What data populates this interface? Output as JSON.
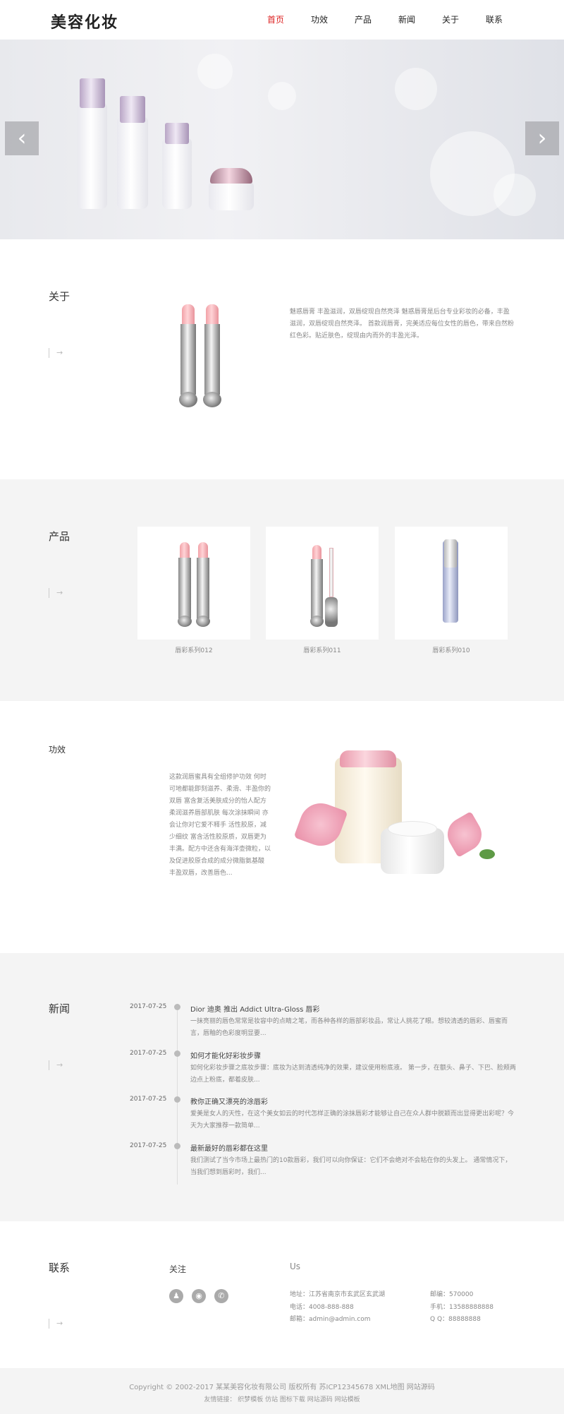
{
  "header": {
    "logo": "美容化妆",
    "nav": [
      "首页",
      "功效",
      "产品",
      "新闻",
      "关于",
      "联系"
    ]
  },
  "banner": {
    "prev_glyph": "‹",
    "next_glyph": "›"
  },
  "about": {
    "title": "关于",
    "more": "→",
    "text": "魅惑唇膏 丰盈滋润，双唇绽现自然亮泽 魅惑唇膏是后台专业彩妆的必备，丰盈滋润，双唇绽现自然亮泽。 首款润唇膏，完美适应每位女性的唇色，带来自然粉红色彩。贴近肤色，绽现由内而外的丰盈光泽。"
  },
  "products": {
    "title": "产品",
    "more": "→",
    "items": [
      {
        "label": "唇彩系列012"
      },
      {
        "label": "唇彩系列011"
      },
      {
        "label": "唇彩系列010"
      }
    ]
  },
  "effect": {
    "title": "功效",
    "text": "这款润唇蜜具有全组修护功效 何时可地都能即刻滋养、柔滑、丰盈你的双唇 富含复活美肤成分的怡人配方 柔润滋养唇部肌肤 每次涂抹瞬间 亦会让你对它爱不释手 活性胶原，减少细纹 富含活性胶原质，双唇更为丰满。配方中还含有海洋壶微粒，以及促进胶原合成的成分微脂氨基酸 丰盈双唇，改善唇色..."
  },
  "news": {
    "title": "新闻",
    "more": "→",
    "items": [
      {
        "date": "2017-07-25",
        "title": "Dior 迪奥 推出 Addict Ultra-Gloss 唇彩",
        "desc": "一抹亮丽的唇色常常是妆容中的点睛之笔，而各种各样的唇部彩妆品，常让人挑花了眼。想较清透的唇彩、唇蜜而言，唇釉的色彩度明显要..."
      },
      {
        "date": "2017-07-25",
        "title": "如何才能化好彩妆步骤",
        "desc": "如何化彩妆步骤之底妆步骤：底妆为达到清透纯净的效果，建议使用粉底液。 第一步，在额头、鼻子、下巴、脸颊两边点上粉底，都着皮肤..."
      },
      {
        "date": "2017-07-25",
        "title": "教你正确又漂亮的涂唇彩",
        "desc": "爱美是女人的天性，在这个美女如云的时代怎样正确的涂抹唇彩才能够让自己在众人群中脱颖而出显得更出彩呢？今天为大家推荐一款简单..."
      },
      {
        "date": "2017-07-25",
        "title": "最新最好的唇彩都在这里",
        "desc": "我们测试了当今市场上最热门的10款唇彩，我们可以向你保证：它们不会绝对不会粘在你的头发上。 通常情况下，当我们想到唇彩时，我们..."
      }
    ]
  },
  "contact": {
    "title": "联系",
    "more": "→",
    "follow_title": "关注",
    "us_title": "Us",
    "social": [
      "♟",
      "◉",
      "✆"
    ],
    "address": "地址：江苏省南京市玄武区玄武湖",
    "phone": "电话：4008-888-888",
    "email": "邮箱：admin@admin.com",
    "postcode": "邮编：570000",
    "mobile": "手机：13588888888",
    "qq": "Q Q：88888888"
  },
  "footer": {
    "copyright": "Copyright © 2002-2017 某某美容化妆有限公司 版权所有 苏ICP12345678 XML地图 网站源码",
    "links": "友情链接： 织梦模板 仿站 图标下载 网站源码 网站模板"
  }
}
